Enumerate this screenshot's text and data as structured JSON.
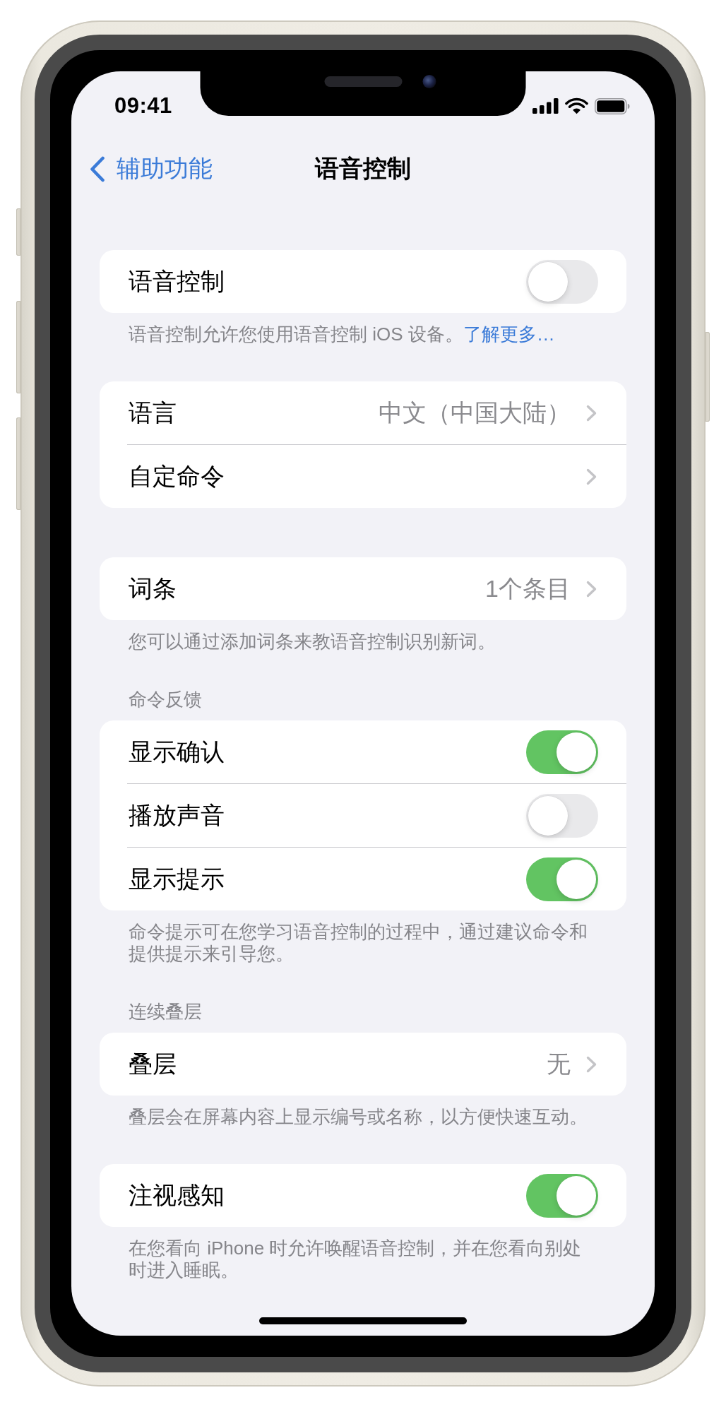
{
  "status_bar": {
    "time": "09:41"
  },
  "navigation": {
    "back_label": "辅助功能",
    "title": "语音控制"
  },
  "sections": [
    {
      "rows": [
        {
          "kind": "toggle",
          "label": "语音控制",
          "on": false
        }
      ],
      "footer": "语音控制允许您使用语音控制 iOS 设备。",
      "footer_link": "了解更多…"
    },
    {
      "rows": [
        {
          "kind": "disclosure",
          "label": "语言",
          "value": "中文（中国大陆）"
        },
        {
          "kind": "disclosure",
          "label": "自定命令"
        }
      ]
    },
    {
      "rows": [
        {
          "kind": "disclosure",
          "label": "词条",
          "value": "1个条目"
        }
      ],
      "footer": "您可以通过添加词条来教语音控制识别新词。"
    },
    {
      "header": "命令反馈",
      "rows": [
        {
          "kind": "toggle",
          "label": "显示确认",
          "on": true
        },
        {
          "kind": "toggle",
          "label": "播放声音",
          "on": false
        },
        {
          "kind": "toggle",
          "label": "显示提示",
          "on": true
        }
      ],
      "footer": "命令提示可在您学习语音控制的过程中，通过建议命令和提供提示来引导您。"
    },
    {
      "header": "连续叠层",
      "rows": [
        {
          "kind": "disclosure",
          "label": "叠层",
          "value": "无"
        }
      ],
      "footer": "叠层会在屏幕内容上显示编号或名称，以方便快速互动。"
    },
    {
      "rows": [
        {
          "kind": "toggle",
          "label": "注视感知",
          "on": true
        }
      ],
      "footer": "在您看向 iPhone 时允许唤醒语音控制，并在您看向别处时进入睡眠。"
    }
  ]
}
